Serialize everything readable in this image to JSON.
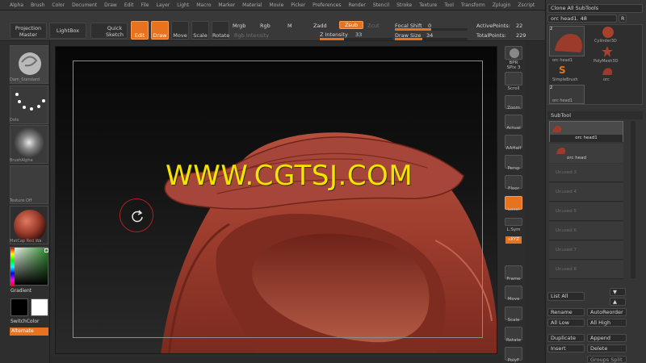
{
  "menu": [
    "Alpha",
    "Brush",
    "Color",
    "Document",
    "Draw",
    "Edit",
    "File",
    "Layer",
    "Light",
    "Macro",
    "Marker",
    "Material",
    "Movie",
    "Picker",
    "Preferences",
    "Render",
    "Stencil",
    "Stroke",
    "Texture",
    "Tool",
    "Transform",
    "Zplugin",
    "Zscript"
  ],
  "toolbar": {
    "projection_master": "Projection Master",
    "lightbox": "LightBox",
    "quick_sketch": "Quick Sketch",
    "edit": "Edit",
    "draw": "Draw",
    "move": "Move",
    "scale": "Scale",
    "rotate": "Rotate",
    "mrgb": "Mrgb",
    "rgb": "Rgb",
    "m": "M",
    "zadd": "Zadd",
    "zsub": "Zsub",
    "zcut": "Zcut",
    "rgb_intensity": "Rgb Intensity",
    "z_intensity_label": "Z Intensity",
    "z_intensity_value": "33",
    "focal_shift_label": "Focal Shift",
    "focal_shift_value": "0",
    "draw_size_label": "Draw Size",
    "draw_size_value": "34",
    "active_points_label": "ActivePoints:",
    "active_points_value": "22",
    "total_points_label": "TotalPoints:",
    "total_points_value": "229"
  },
  "left_shelf": {
    "brush_label": "Dam_Standard",
    "stroke_label": "Dots",
    "alpha_label": "BrushAlpha",
    "texture_label": "Texture Off",
    "material_label": "MatCap Red Wa",
    "gradient_label": "Gradient",
    "switch_color_label": "SwitchColor",
    "alternate_label": "Alternate"
  },
  "right_icons": {
    "bpr": "BPR",
    "spix_label": "SPix",
    "spix_value": "3",
    "scroll": "Scroll",
    "zoom": "Zoom",
    "actual": "Actual",
    "aahalf": "AAHalf",
    "persp": "Persp",
    "floor": "Floor",
    "local": "Local",
    "lsym": "L.Sym",
    "xyz": "»XYZ",
    "frame": "Frame",
    "move": "Move",
    "scale": "Scale",
    "rotate": "Rotate",
    "polyf": "PolyF"
  },
  "tool_panel": {
    "clone_all": "Clone All SubTools",
    "current_tool": "orc head1. 48",
    "r_button": "R",
    "tool_thumbs": [
      "orc head1",
      "Cylinder3D",
      "PolyMesh3D",
      "SimpleBrush",
      "orc",
      "orc head1"
    ],
    "thumb_counts": [
      "2",
      "2"
    ],
    "subtool_header": "SubTool",
    "subtool_items": [
      "orc head1",
      "orc head"
    ],
    "empty_slots": [
      "Unused 3",
      "Unused 4",
      "Unused 5",
      "Unused 6",
      "Unused 7",
      "Unused 8"
    ],
    "list_all": "List All",
    "rename": "Rename",
    "auto_reorder": "AutoReorder",
    "all_low": "All Low",
    "all_high": "All High",
    "duplicate": "Duplicate",
    "append": "Append",
    "insert": "Insert",
    "delete": "Delete",
    "groups_split": "Groups Split"
  },
  "watermark": "WWW.CGTSJ.COM",
  "colors": {
    "accent": "#e8731f",
    "watermark": "#f5e300",
    "sculpt": "#9a3b2c"
  }
}
